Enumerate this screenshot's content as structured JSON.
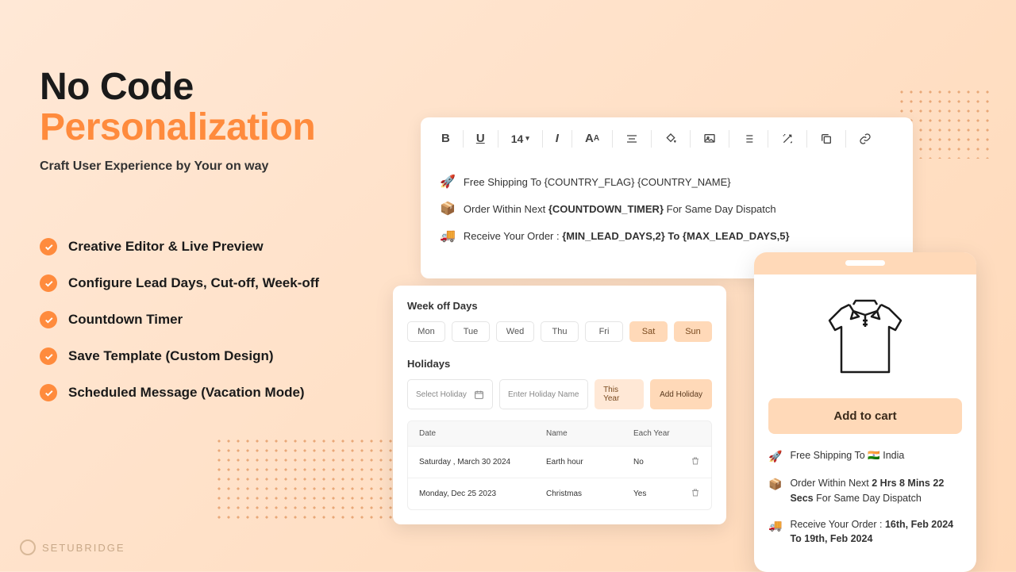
{
  "hero": {
    "title_line1": "No Code",
    "title_line2": "Personalization",
    "subtitle": "Craft User Experience by Your on way"
  },
  "features": [
    "Creative Editor & Live Preview",
    "Configure Lead Days, Cut-off, Week-off",
    "Countdown Timer",
    "Save Template (Custom Design)",
    "Scheduled Message (Vacation Mode)"
  ],
  "toolbar": {
    "fontsize": "14"
  },
  "editor_lines": {
    "l1": "Free Shipping To {COUNTRY_FLAG} {COUNTRY_NAME}",
    "l2_a": "Order Within Next ",
    "l2_b": "{COUNTDOWN_TIMER}",
    "l2_c": " For Same Day Dispatch",
    "l3_a": "Receive Your Order :  ",
    "l3_b": "{MIN_LEAD_DAYS,2} To  {MAX_LEAD_DAYS,5}"
  },
  "config": {
    "weekoff_title": "Week off Days",
    "days": [
      "Mon",
      "Tue",
      "Wed",
      "Thu",
      "Fri",
      "Sat",
      "Sun"
    ],
    "weekend_selected": [
      "Sat",
      "Sun"
    ],
    "holidays_title": "Holidays",
    "select_holiday": "Select Holiday",
    "enter_name": "Enter Holiday Name",
    "this_year": "This Year",
    "add_btn": "Add Holiday",
    "cols": {
      "date": "Date",
      "name": "Name",
      "each": "Each Year"
    },
    "rows": [
      {
        "date": "Saturday , March 30 2024",
        "name": "Earth hour",
        "each": "No"
      },
      {
        "date": "Monday, Dec  25  2023",
        "name": "Christmas",
        "each": "Yes"
      }
    ]
  },
  "phone": {
    "atc": "Add to cart",
    "ship_a": "Free Shipping To ",
    "ship_flag": "🇮🇳",
    "ship_b": " India",
    "timer_a": "Order Within Next ",
    "timer_b": "2 Hrs 8 Mins 22 Secs",
    "timer_c": " For Same Day Dispatch",
    "recv_a": "Receive Your Order :  ",
    "recv_b": "16th, Feb 2024 To 19th, Feb 2024"
  },
  "brand": "SETUBRIDGE"
}
